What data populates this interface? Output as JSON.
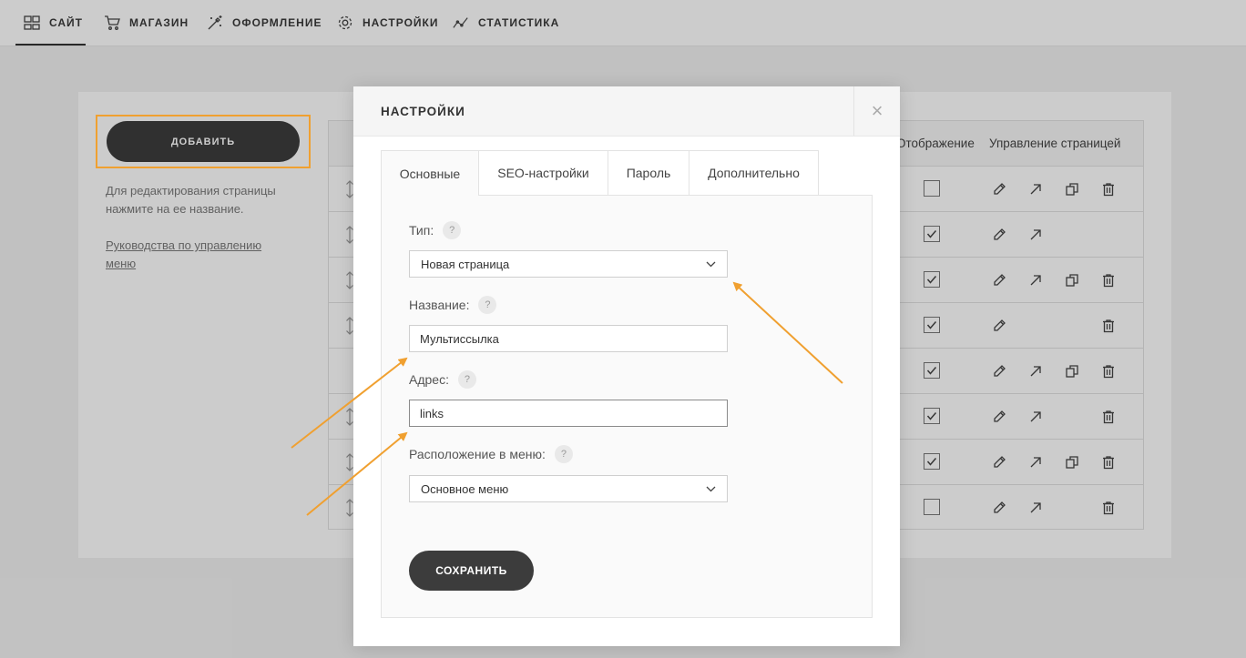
{
  "colors": {
    "accent": "#f0a030",
    "button": "#3c3c3c",
    "overlay": "rgba(0,0,0,0.2)"
  },
  "nav": {
    "items": [
      {
        "label": "САЙТ",
        "icon": "grid-icon",
        "active": true
      },
      {
        "label": "МАГАЗИН",
        "icon": "cart-icon",
        "active": false
      },
      {
        "label": "ОФОРМЛЕНИЕ",
        "icon": "magic-wand-icon",
        "active": false
      },
      {
        "label": "НАСТРОЙКИ",
        "icon": "gear-icon",
        "active": false
      },
      {
        "label": "СТАТИСТИКА",
        "icon": "stats-line-icon",
        "active": false
      }
    ]
  },
  "sidebar": {
    "add_button": "ДОБАВИТЬ",
    "hint": "Для редактирования страницы нажмите на ее название.",
    "guide_link": "Руководства по управлению меню"
  },
  "table": {
    "header_display": "Отображение",
    "header_manage": "Управление страницей",
    "rows": [
      {
        "drag": true,
        "visible": false,
        "actions": [
          "edit",
          "open",
          "copy",
          "delete"
        ]
      },
      {
        "drag": true,
        "visible": true,
        "actions": [
          "edit",
          "open"
        ]
      },
      {
        "drag": true,
        "visible": true,
        "actions": [
          "edit",
          "open",
          "copy",
          "delete"
        ]
      },
      {
        "drag": true,
        "visible": true,
        "actions": [
          "edit",
          "delete"
        ]
      },
      {
        "drag": false,
        "visible": true,
        "actions": [
          "edit",
          "open",
          "copy",
          "delete"
        ]
      },
      {
        "drag": true,
        "visible": true,
        "actions": [
          "edit",
          "open",
          "delete"
        ]
      },
      {
        "drag": true,
        "visible": true,
        "actions": [
          "edit",
          "open",
          "copy",
          "delete"
        ]
      },
      {
        "drag": true,
        "visible": false,
        "actions": [
          "edit",
          "open",
          "delete"
        ]
      }
    ]
  },
  "modal": {
    "title": "НАСТРОЙКИ",
    "close": "×",
    "tabs": [
      {
        "label": "Основные",
        "active": true
      },
      {
        "label": "SEO-настройки",
        "active": false
      },
      {
        "label": "Пароль",
        "active": false
      },
      {
        "label": "Дополнительно",
        "active": false
      }
    ],
    "form": {
      "help": "?",
      "type_label": "Тип:",
      "type_value": "Новая страница",
      "name_label": "Название:",
      "name_value": "Мультиссылка",
      "address_label": "Адрес:",
      "address_value": "links",
      "menu_label": "Расположение в меню:",
      "menu_value": "Основное меню"
    },
    "save_button": "СОХРАНИТЬ"
  }
}
